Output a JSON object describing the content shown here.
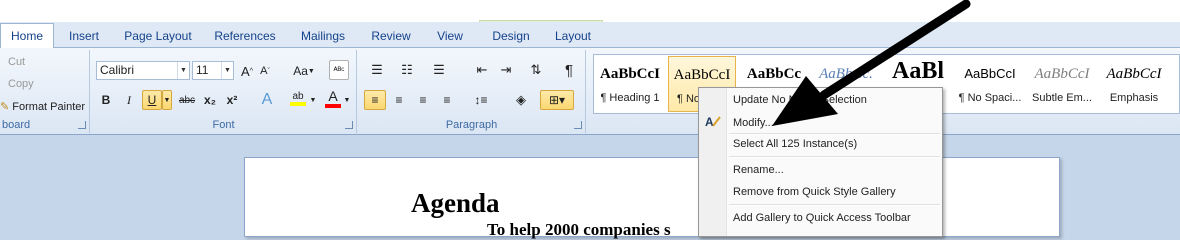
{
  "tabs": [
    {
      "label": "Home",
      "active": true
    },
    {
      "label": "Insert"
    },
    {
      "label": "Page Layout"
    },
    {
      "label": "References"
    },
    {
      "label": "Mailings"
    },
    {
      "label": "Review"
    },
    {
      "label": "View"
    },
    {
      "label": "Design",
      "context": true
    },
    {
      "label": "Layout",
      "context": true
    }
  ],
  "clipboard": {
    "cut": "Cut",
    "copy": "Copy",
    "format_painter": "Format Painter",
    "label": "board"
  },
  "font": {
    "name": "Calibri",
    "size": "11",
    "grow": "A",
    "shrink": "A",
    "change_case": "Aa",
    "bold": "B",
    "italic": "I",
    "underline": "U",
    "strikethrough": "abc",
    "subscript": "x₂",
    "superscript": "x²",
    "text_effects": "A",
    "highlight": "ab",
    "font_color": "A",
    "label": "Font"
  },
  "paragraph": {
    "label": "Paragraph",
    "show_marks": "¶"
  },
  "styles": [
    {
      "sample": "AaBbCcI",
      "name": "¶ Heading 1",
      "bold": true
    },
    {
      "sample": "AaBbCcI",
      "name": "¶ No",
      "selected": true
    },
    {
      "sample": "AaBbCc",
      "name": "",
      "bold": true
    },
    {
      "sample": "AaBbCc.",
      "name": "",
      "italic": true,
      "color": "#5a7fb6"
    },
    {
      "sample": "AaBl",
      "name": "",
      "bold": true,
      "large": true
    },
    {
      "sample": "AaBbCcI",
      "name": "¶ No Spaci..."
    },
    {
      "sample": "AaBbCcI",
      "name": "Subtle Em...",
      "italic": true,
      "color": "#7f7f7f"
    },
    {
      "sample": "AaBbCcI",
      "name": "Emphasis",
      "italic": true
    }
  ],
  "document": {
    "title": "Agenda",
    "subtitle": "To help 2000 companies s"
  },
  "context_menu": {
    "items": [
      {
        "label": "Update No  Match Selection"
      },
      {
        "label": "Modify..."
      },
      {
        "label": "Select All 125 Instance(s)"
      },
      {
        "label": "Rename..."
      },
      {
        "label": "Remove from Quick Style Gallery"
      },
      {
        "label": "Add Gallery to Quick Access Toolbar"
      }
    ]
  },
  "colors": {
    "accent": "#15428b",
    "highlight": "#fbd871",
    "font_color_bar": "#ff0000",
    "highlight_bar": "#ffff00"
  }
}
